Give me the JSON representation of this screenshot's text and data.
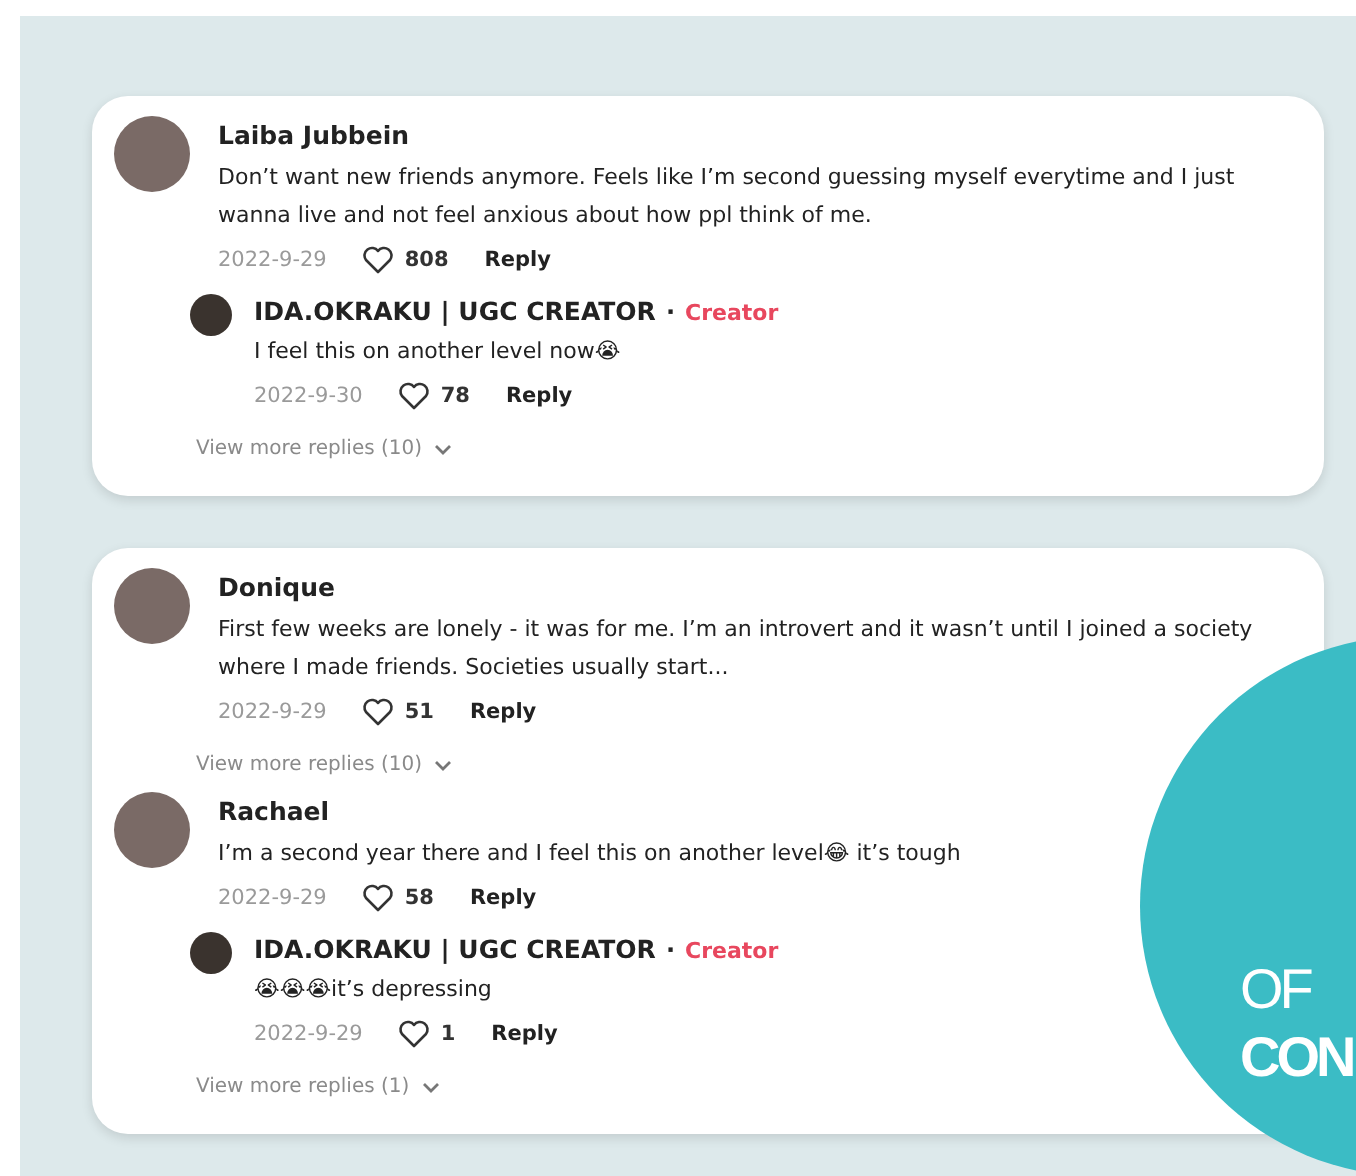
{
  "cards": [
    {
      "comments": [
        {
          "name": "Laiba Jubbein",
          "text": "Don’t want new friends anymore. Feels like I’m second guessing myself everytime and I just wanna live and not feel anxious about how ppl think of me.",
          "date": "2022-9-29",
          "likes": "808",
          "reply_label": "Reply",
          "replies": [
            {
              "name": "IDA.OKRAKU | UGC CREATOR",
              "separator": "·",
              "badge": "Creator",
              "text": "I feel this on another level now😭",
              "date": "2022-9-30",
              "likes": "78",
              "reply_label": "Reply"
            }
          ],
          "view_more": "View more replies (10)"
        }
      ]
    },
    {
      "comments": [
        {
          "name": "Donique",
          "text": "First few weeks are lonely - it was for me. I’m an introvert and it wasn’t until I joined a society where I made friends. Societies usually start...",
          "date": "2022-9-29",
          "likes": "51",
          "reply_label": "Reply",
          "view_more": "View more replies (10)"
        },
        {
          "name": "Rachael",
          "text": "I’m a second year there and I feel this on another level😂 it’s tough",
          "date": "2022-9-29",
          "likes": "58",
          "reply_label": "Reply",
          "replies": [
            {
              "name": "IDA.OKRAKU | UGC CREATOR",
              "separator": "·",
              "badge": "Creator",
              "text": "😭😭😭it’s depressing",
              "date": "2022-9-29",
              "likes": "1",
              "reply_label": "Reply"
            }
          ],
          "view_more": "View more replies (1)"
        }
      ]
    }
  ],
  "corner_badge": {
    "lines": [
      "OF",
      "CON"
    ]
  }
}
